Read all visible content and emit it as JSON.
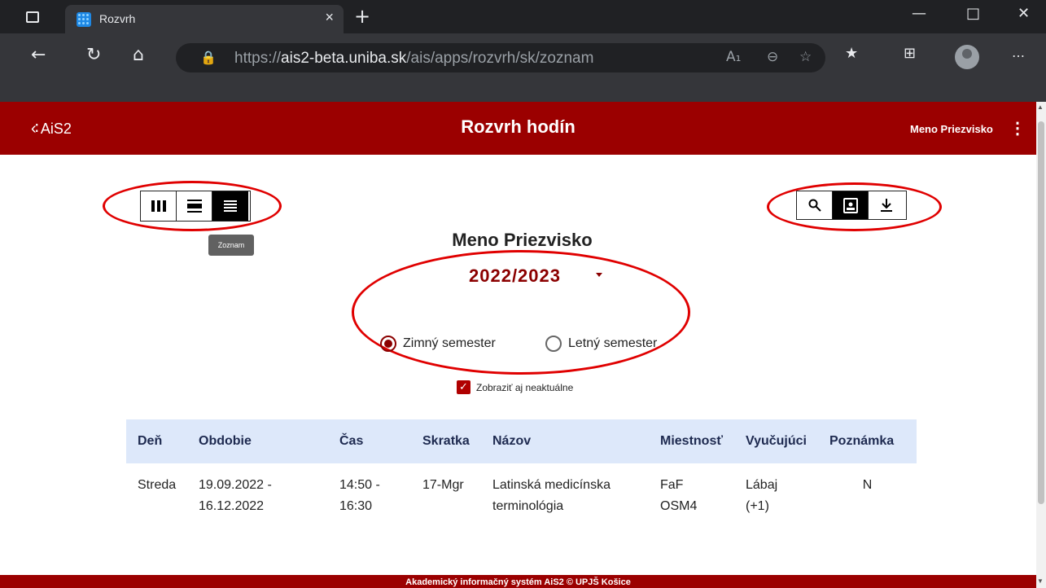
{
  "browser": {
    "tab_title": "Rozvrh",
    "tab_close": "×",
    "new_tab": "+",
    "url_prefix": "https://",
    "url_domain": "ais2-beta.uniba.sk",
    "url_path": "/ais/apps/rozvrh/sk/zoznam",
    "icons": [
      "tab-actions-icon",
      "app-favicon-icon",
      "close-icon",
      "plus-icon",
      "minimize-icon",
      "maximize-icon",
      "close-window-icon",
      "back-icon",
      "refresh-icon",
      "home-icon",
      "lock-icon",
      "read-aloud-icon",
      "zoom-out-icon",
      "add-favorite-icon",
      "favorites-icon",
      "collections-icon",
      "profile-avatar",
      "more-icon"
    ]
  },
  "header": {
    "logo": "AiS2",
    "title": "Rozvrh hodín",
    "user": "Meno Priezvisko"
  },
  "toolbar": {
    "tooltip": "Zoznam",
    "view_buttons": [
      "columns-view",
      "rows-view",
      "list-view"
    ],
    "active_view": "list-view",
    "tool_buttons": [
      "search",
      "contact",
      "download"
    ],
    "active_tool": "contact"
  },
  "main": {
    "person_name": "Meno Priezvisko",
    "year": "2022/2023",
    "semester_winter": "Zimný semester",
    "semester_summer": "Letný semester",
    "selected_semester": "Zimný semester",
    "checkbox_label": "Zobraziť aj neaktuálne",
    "checkbox_checked": true
  },
  "table": {
    "headers": [
      "Deň",
      "Obdobie",
      "Čas",
      "Skratka",
      "Názov",
      "Miestnosť",
      "Vyučujúci",
      "Poznámka"
    ],
    "rows": [
      {
        "den": "Streda",
        "obdobie_1": "19.09.2022 -",
        "obdobie_2": "16.12.2022",
        "cas_1": "14:50 -",
        "cas_2": "16:30",
        "skratka": "17-Mgr",
        "nazov_1": "Latinská medicínska",
        "nazov_2": "terminológia",
        "miestnost_1": "FaF",
        "miestnost_2": "OSM4",
        "vyucujuci_1": "Lábaj",
        "vyucujuci_2": "(+1)",
        "poznamka": "N"
      }
    ]
  },
  "footer": {
    "text": "Akademický informačný systém AiS2 © UPJŠ Košice"
  },
  "colors": {
    "brand": "#9b0000",
    "year_text": "#8b0000",
    "table_header_bg": "#dde8fa",
    "annotation": "#e00000"
  }
}
